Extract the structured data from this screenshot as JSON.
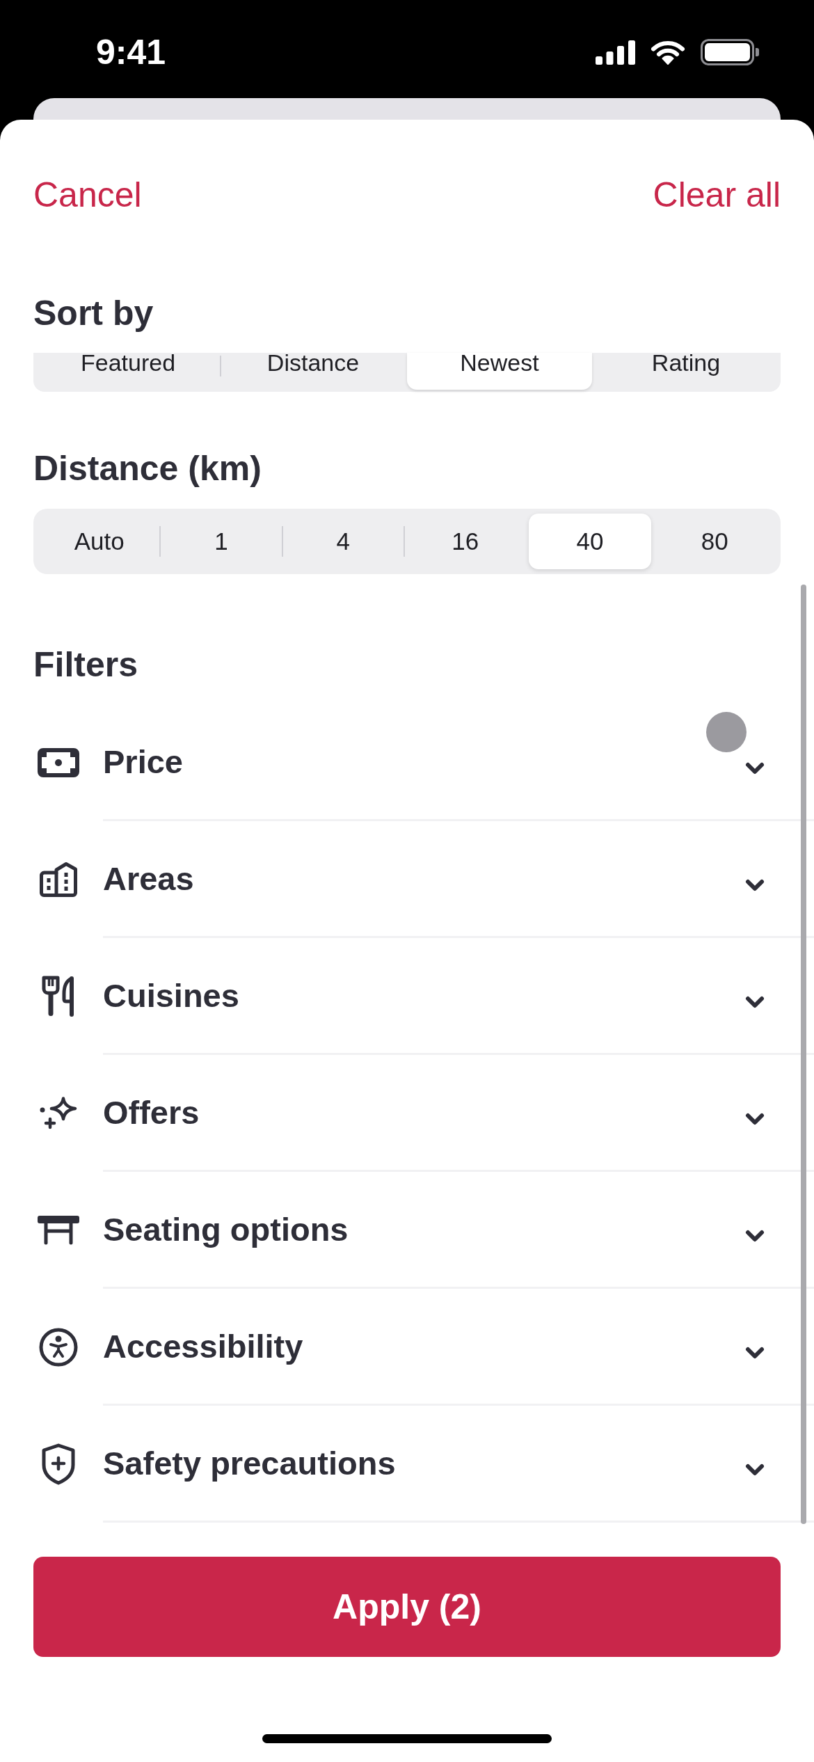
{
  "status_bar": {
    "time": "9:41"
  },
  "header": {
    "cancel": "Cancel",
    "clear_all": "Clear all"
  },
  "sort": {
    "title": "Sort by",
    "options": [
      {
        "label": "Featured",
        "selected": false
      },
      {
        "label": "Distance",
        "selected": false
      },
      {
        "label": "Newest",
        "selected": true
      },
      {
        "label": "Rating",
        "selected": false
      }
    ]
  },
  "distance": {
    "title": "Distance (km)",
    "options": [
      {
        "label": "Auto",
        "selected": false
      },
      {
        "label": "1",
        "selected": false
      },
      {
        "label": "4",
        "selected": false
      },
      {
        "label": "16",
        "selected": false
      },
      {
        "label": "40",
        "selected": true
      },
      {
        "label": "80",
        "selected": false
      }
    ]
  },
  "filters": {
    "title": "Filters",
    "items": [
      {
        "label": "Price",
        "expanded": false
      },
      {
        "label": "Areas",
        "expanded": false
      },
      {
        "label": "Cuisines",
        "expanded": false
      },
      {
        "label": "Offers",
        "expanded": false
      },
      {
        "label": "Seating options",
        "expanded": false
      },
      {
        "label": "Accessibility",
        "expanded": false
      },
      {
        "label": "Safety precautions",
        "expanded": false
      }
    ]
  },
  "apply_button": {
    "label": "Apply (2)"
  }
}
